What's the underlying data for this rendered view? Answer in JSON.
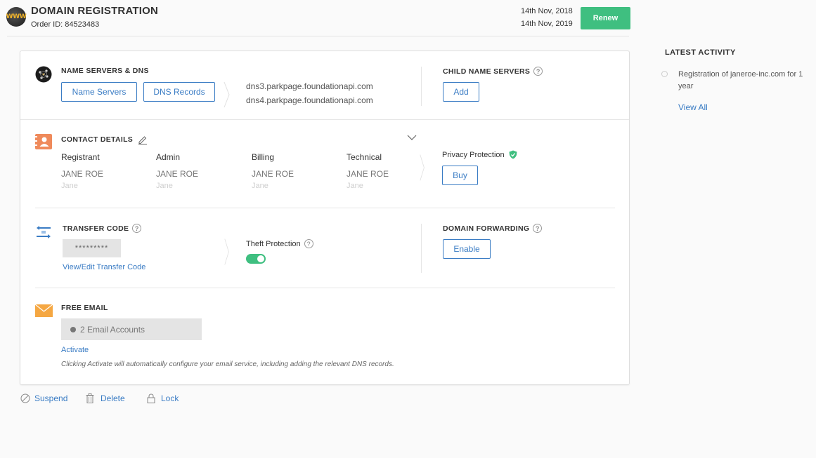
{
  "header": {
    "logo_text": "WWW",
    "title": "DOMAIN REGISTRATION",
    "order_id": "Order ID: 84523483",
    "date_start": "14th Nov, 2018",
    "date_end": "14th Nov, 2019",
    "renew_label": "Renew"
  },
  "name_servers": {
    "title": "NAME SERVERS & DNS",
    "name_servers_button": "Name Servers",
    "dns_records_button": "DNS Records",
    "servers": [
      "dns3.parkpage.foundationapi.com",
      "dns4.parkpage.foundationapi.com"
    ]
  },
  "child_name_servers": {
    "title": "CHILD NAME SERVERS",
    "add_button": "Add"
  },
  "contact_details": {
    "title": "CONTACT DETAILS",
    "columns": [
      {
        "role": "Registrant",
        "name": "JANE ROE",
        "first": "Jane"
      },
      {
        "role": "Admin",
        "name": "JANE ROE",
        "first": "Jane"
      },
      {
        "role": "Billing",
        "name": "JANE ROE",
        "first": "Jane"
      },
      {
        "role": "Technical",
        "name": "JANE ROE",
        "first": "Jane"
      }
    ]
  },
  "privacy": {
    "title": "Privacy Protection",
    "buy_button": "Buy"
  },
  "transfer_code": {
    "title": "TRANSFER CODE",
    "masked_code": "*********",
    "view_edit_link": "View/Edit Transfer Code"
  },
  "theft_protection": {
    "title": "Theft Protection",
    "enabled": true
  },
  "domain_forwarding": {
    "title": "DOMAIN FORWARDING",
    "enable_button": "Enable"
  },
  "free_email": {
    "title": "FREE EMAIL",
    "accounts": "2 Email Accounts",
    "activate_link": "Activate",
    "note": "Clicking Activate will automatically configure your email service, including adding the relevant DNS records."
  },
  "actions": {
    "suspend": "Suspend",
    "delete": "Delete",
    "lock": "Lock"
  },
  "activity": {
    "title": "LATEST ACTIVITY",
    "items": [
      "Registration of janeroe-inc.com for 1 year"
    ],
    "view_all": "View All"
  },
  "colors": {
    "accent": "#3a7cc4",
    "success": "#3fbf80"
  }
}
